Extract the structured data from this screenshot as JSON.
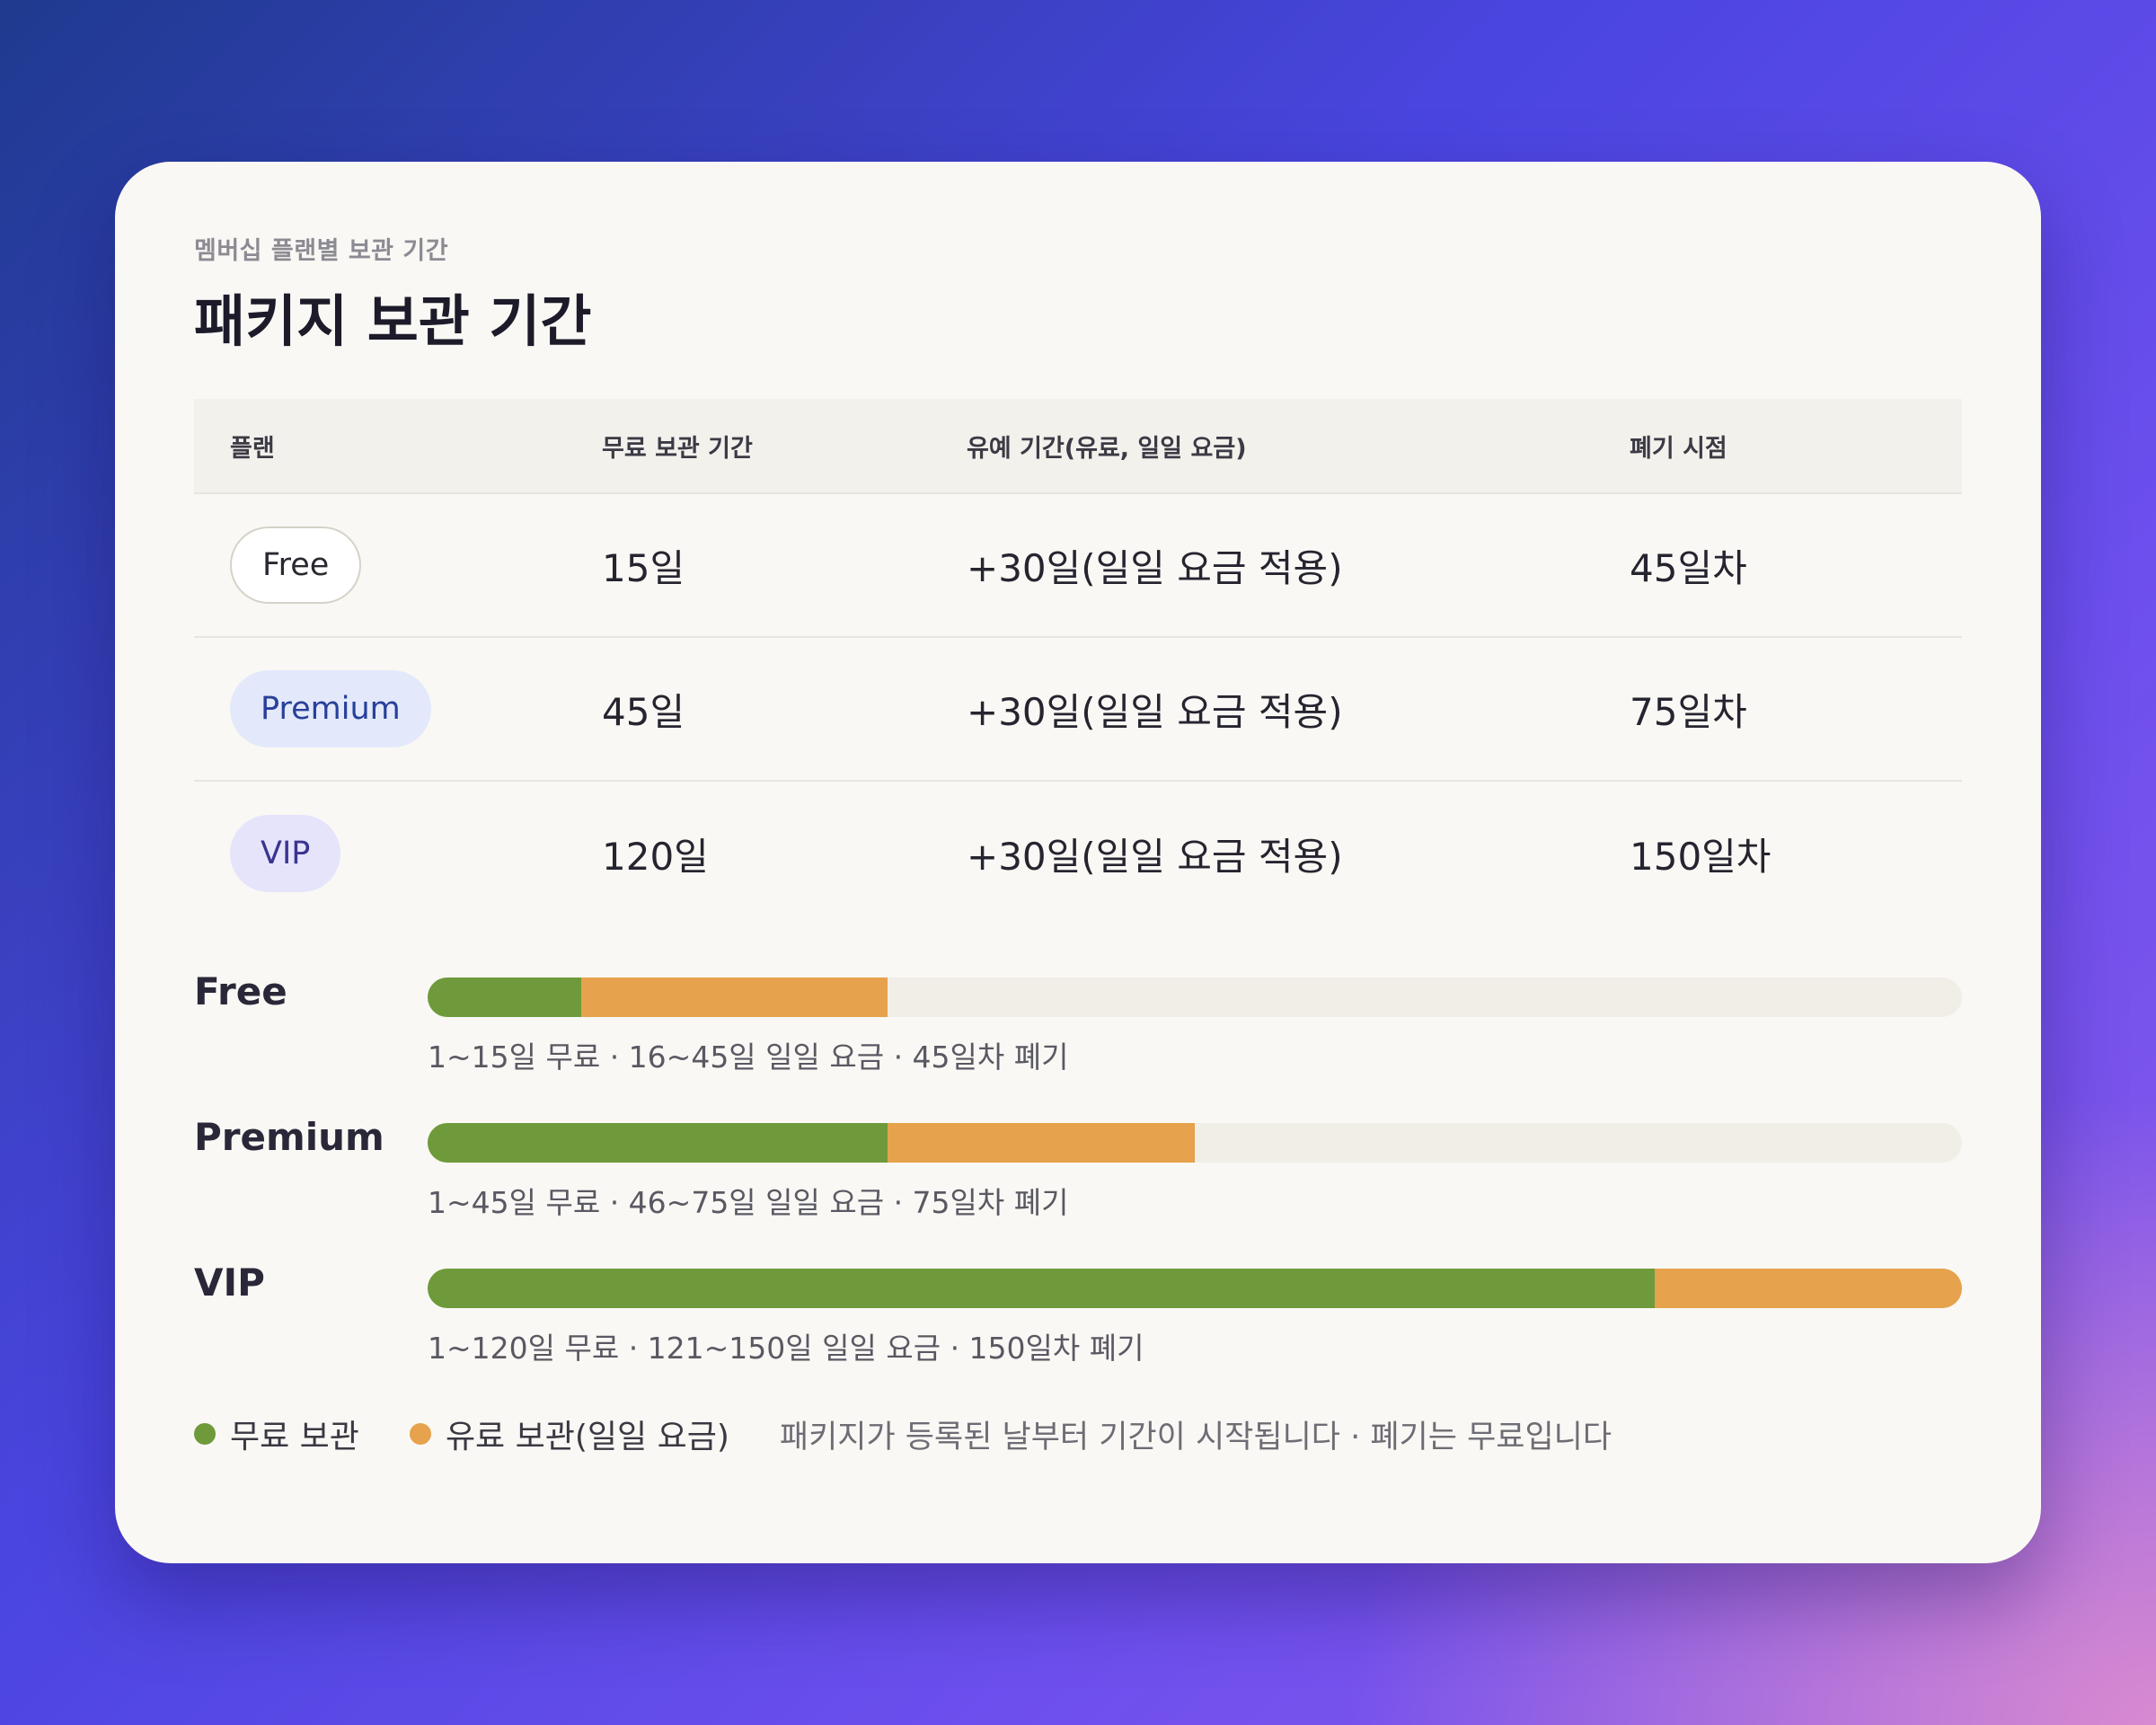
{
  "header": {
    "eyebrow": "멤버십 플랜별 보관 기간",
    "title": "패키지 보관 기간"
  },
  "table": {
    "columns": [
      "플랜",
      "무료 보관 기간",
      "유예 기간(유료, 일일 요금)",
      "폐기 시점"
    ],
    "rows": [
      {
        "plan": "Free",
        "free_period": "15일",
        "grace": "+30일(일일 요금 적용)",
        "disposal": "45일차"
      },
      {
        "plan": "Premium",
        "free_period": "45일",
        "grace": "+30일(일일 요금 적용)",
        "disposal": "75일차"
      },
      {
        "plan": "VIP",
        "free_period": "120일",
        "grace": "+30일(일일 요금 적용)",
        "disposal": "150일차"
      }
    ]
  },
  "timeline": {
    "max_days": 150,
    "items": [
      {
        "name": "Free",
        "free_days": 15,
        "paid_days": 30,
        "caption": "1~15일 무료 · 16~45일 일일 요금 · 45일차 폐기"
      },
      {
        "name": "Premium",
        "free_days": 45,
        "paid_days": 30,
        "caption": "1~45일 무료 · 46~75일 일일 요금 · 75일차 폐기"
      },
      {
        "name": "VIP",
        "free_days": 120,
        "paid_days": 30,
        "caption": "1~120일 무료 · 121~150일 일일 요금 · 150일차 폐기"
      }
    ]
  },
  "legend": {
    "free_label": "무료 보관",
    "paid_label": "유료 보관(일일 요금)",
    "note": "패키지가 등록된 날부터 기간이 시작됩니다 · 폐기는 무료입니다"
  },
  "colors": {
    "free": "#6f9a3b",
    "paid": "#e6a24c",
    "track": "#f1eee8"
  }
}
